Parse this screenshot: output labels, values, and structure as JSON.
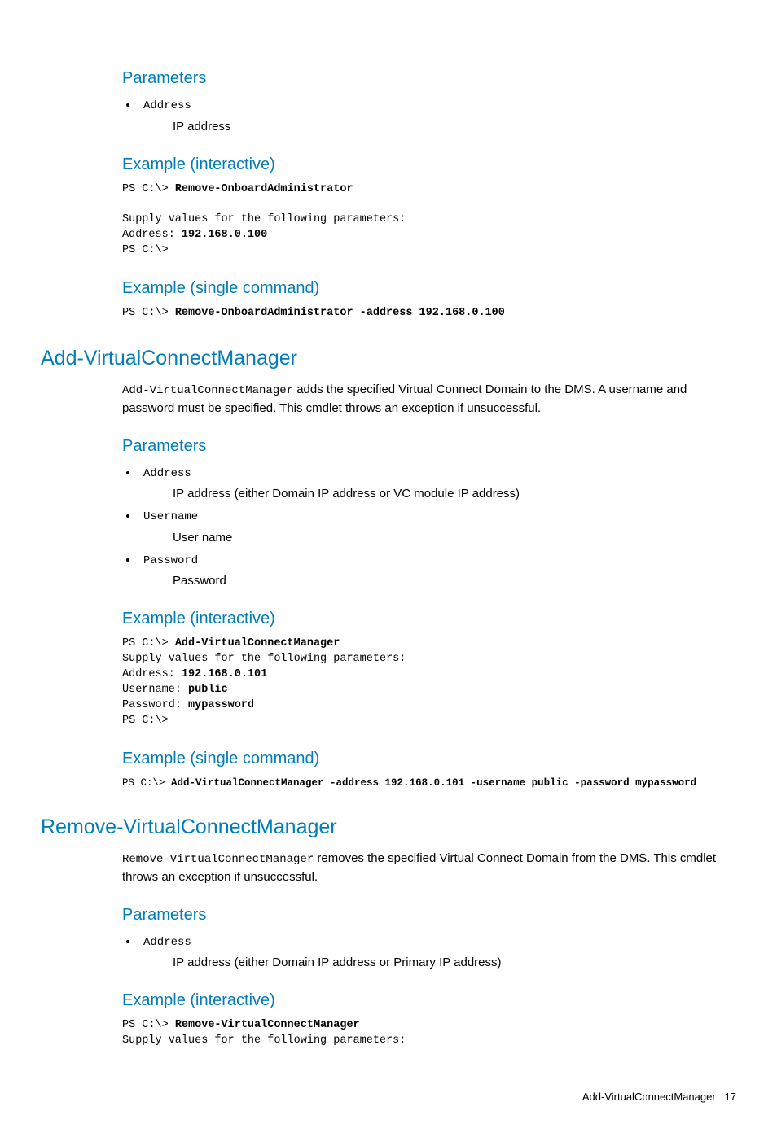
{
  "s1": {
    "parameters_h": "Parameters",
    "params": [
      {
        "name": "Address",
        "desc": "IP address"
      }
    ],
    "ex_interactive_h": "Example (interactive)",
    "ex_i_l1": "PS C:\\> ",
    "ex_i_l1b": "Remove-OnboardAdministrator",
    "ex_i_l2": "Supply values for the following parameters:",
    "ex_i_l3a": "Address: ",
    "ex_i_l3b": "192.168.0.100",
    "ex_i_l4": "PS C:\\>",
    "ex_single_h": "Example (single command)",
    "ex_s_l1a": "PS C:\\> ",
    "ex_s_l1b": "Remove-OnboardAdministrator -address 192.168.0.100"
  },
  "s2": {
    "title": "Add-VirtualConnectManager",
    "cmd": "Add-VirtualConnectManager",
    "desc_rest": " adds the specified Virtual Connect Domain to the DMS. A username and password must be specified. This cmdlet throws an exception if unsuccessful.",
    "parameters_h": "Parameters",
    "params": [
      {
        "name": "Address",
        "desc": "IP address (either Domain IP address or VC module IP address)"
      },
      {
        "name": "Username",
        "desc": "User name"
      },
      {
        "name": "Password",
        "desc": "Password"
      }
    ],
    "ex_interactive_h": "Example (interactive)",
    "ex_i_l1a": "PS C:\\> ",
    "ex_i_l1b": "Add-VirtualConnectManager",
    "ex_i_l2": "Supply values for the following parameters:",
    "ex_i_l3a": "Address: ",
    "ex_i_l3b": "192.168.0.101",
    "ex_i_l4a": "Username: ",
    "ex_i_l4b": "public",
    "ex_i_l5a": "Password: ",
    "ex_i_l5b": "mypassword",
    "ex_i_l6": "PS C:\\>",
    "ex_single_h": "Example (single command)",
    "ex_s_l1a": "PS C:\\> ",
    "ex_s_l1b": "Add-VirtualConnectManager -address 192.168.0.101 -username public -password mypassword"
  },
  "s3": {
    "title": "Remove-VirtualConnectManager",
    "cmd": "Remove-VirtualConnectManager",
    "desc_rest": "  removes the specified Virtual Connect Domain from the DMS. This cmdlet throws an exception if unsuccessful.",
    "parameters_h": "Parameters",
    "params": [
      {
        "name": "Address",
        "desc": "IP address (either Domain IP address or Primary IP address)"
      }
    ],
    "ex_interactive_h": "Example (interactive)",
    "ex_i_l1a": "PS C:\\> ",
    "ex_i_l1b": "Remove-VirtualConnectManager",
    "ex_i_l2": "Supply values for the following parameters:"
  },
  "footer": {
    "text": "Add-VirtualConnectManager",
    "page": "17"
  }
}
